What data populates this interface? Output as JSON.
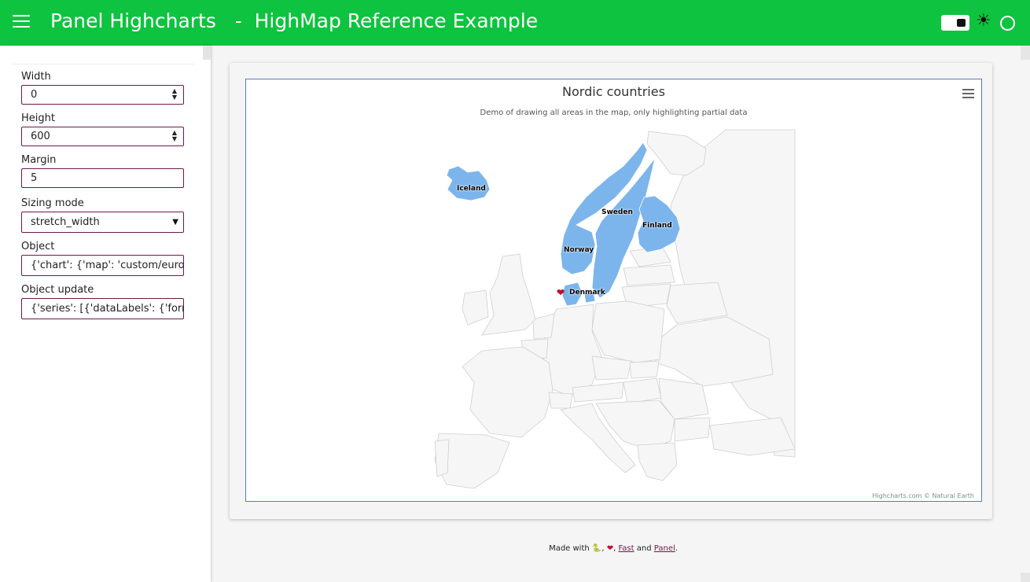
{
  "header": {
    "menu_icon": "hamburger-icon",
    "title": "Panel Highcharts   -  HighMap Reference Example",
    "theme_toggle_icon": "toggle-icon",
    "theme_icon": "sun-icon",
    "circle_icon": "circle-icon",
    "bg_color": "#0ec33f"
  },
  "sidebar": {
    "width_label": "Width",
    "width_value": "0",
    "height_label": "Height",
    "height_value": "600",
    "margin_label": "Margin",
    "margin_value": "5",
    "sizing_label": "Sizing mode",
    "sizing_value": "stretch_width",
    "object_label": "Object",
    "object_value": "{'chart': {'map': 'custom/europe",
    "object_update_label": "Object update",
    "object_update_value": "{'series': [{'dataLabels': {'format"
  },
  "chart": {
    "title": "Nordic countries",
    "subtitle": "Demo of drawing all areas in the map, only highlighting partial data",
    "credits": "Highcharts.com © Natural Earth",
    "highlight_color": "#7cb5ec",
    "labels": {
      "iceland": "Iceland",
      "sweden": "Sweden",
      "finland": "Finland",
      "norway": "Norway",
      "denmark": "Denmark",
      "denmark_icon": "❤"
    }
  },
  "footer": {
    "made_with": "Made with",
    "snake_icon": "🐍",
    "heart_icon": "❤",
    "fast_link": "Fast",
    "and": "and",
    "panel_link": "Panel"
  }
}
